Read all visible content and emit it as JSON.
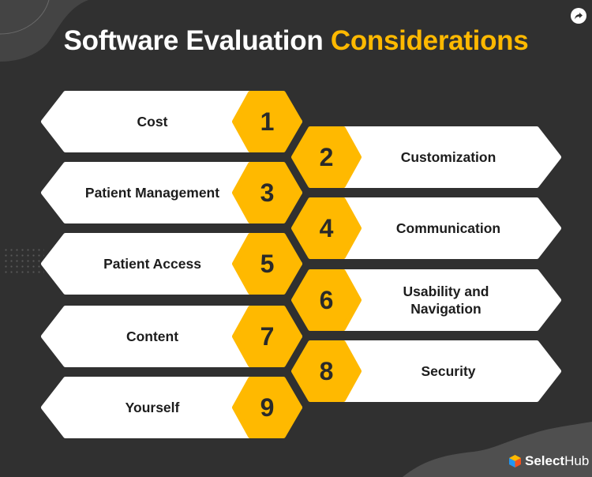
{
  "title": {
    "main": "Software Evaluation",
    "accent": "Considerations",
    "accent_color": "#ffb900"
  },
  "share_button": {
    "icon": "share-arrow-icon"
  },
  "items": [
    {
      "number": "1",
      "label": "Cost",
      "side": "left"
    },
    {
      "number": "2",
      "label": "Customization",
      "side": "right"
    },
    {
      "number": "3",
      "label": "Patient Management",
      "side": "left"
    },
    {
      "number": "4",
      "label": "Communication",
      "side": "right"
    },
    {
      "number": "5",
      "label": "Patient Access",
      "side": "left"
    },
    {
      "number": "6",
      "label": "Usability and Navigation",
      "side": "right"
    },
    {
      "number": "7",
      "label": "Content",
      "side": "left"
    },
    {
      "number": "8",
      "label": "Security",
      "side": "right"
    },
    {
      "number": "9",
      "label": "Yourself",
      "side": "left"
    }
  ],
  "colors": {
    "background": "#303030",
    "card": "#ffffff",
    "hex_badge": "#ffb900",
    "text": "#1c1c1c"
  },
  "branding": {
    "logo_bold": "Select",
    "logo_light": "Hub",
    "logo_icon": "cube-icon"
  }
}
